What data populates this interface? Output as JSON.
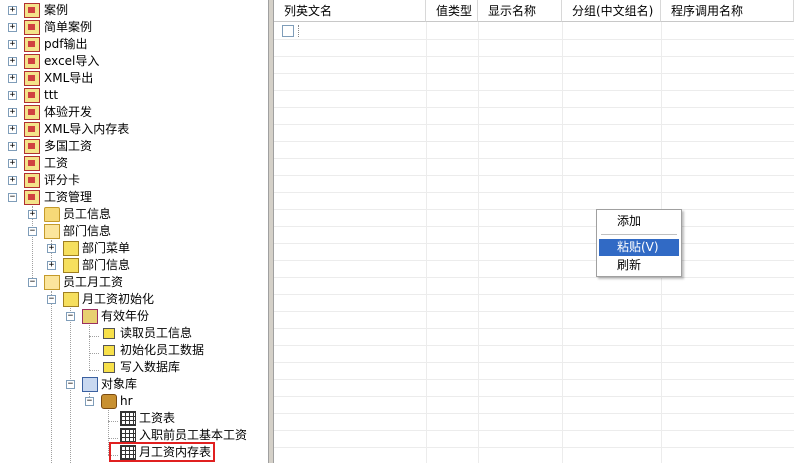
{
  "tree": {
    "nodes": [
      {
        "label": "案例"
      },
      {
        "label": "简单案例"
      },
      {
        "label": "pdf输出"
      },
      {
        "label": "excel导入"
      },
      {
        "label": "XML导出"
      },
      {
        "label": "ttt"
      },
      {
        "label": "体验开发"
      },
      {
        "label": "XML导入内存表"
      },
      {
        "label": "多国工资"
      },
      {
        "label": "工资"
      },
      {
        "label": "评分卡"
      },
      {
        "label": "工资管理"
      },
      {
        "label": "员工信息"
      },
      {
        "label": "部门信息"
      },
      {
        "label": "部门菜单"
      },
      {
        "label": "部门信息"
      },
      {
        "label": "员工月工资"
      },
      {
        "label": "月工资初始化"
      },
      {
        "label": "有效年份"
      },
      {
        "label": "读取员工信息"
      },
      {
        "label": "初始化员工数据"
      },
      {
        "label": "写入数据库"
      },
      {
        "label": "对象库"
      },
      {
        "label": "hr"
      },
      {
        "label": "工资表"
      },
      {
        "label": "入职前员工基本工资"
      },
      {
        "label": "月工资内存表"
      }
    ]
  },
  "grid": {
    "columns": [
      "列英文名",
      "值类型",
      "显示名称",
      "分组(中文组名)",
      "程序调用名称"
    ]
  },
  "context_menu": {
    "items": [
      {
        "label": "添加",
        "highlighted": false
      },
      {
        "label": "粘贴(V)",
        "highlighted": true
      },
      {
        "label": "刷新",
        "highlighted": false
      }
    ]
  },
  "colors": {
    "highlight": "#316ac5",
    "selection_outline": "#e02020"
  }
}
